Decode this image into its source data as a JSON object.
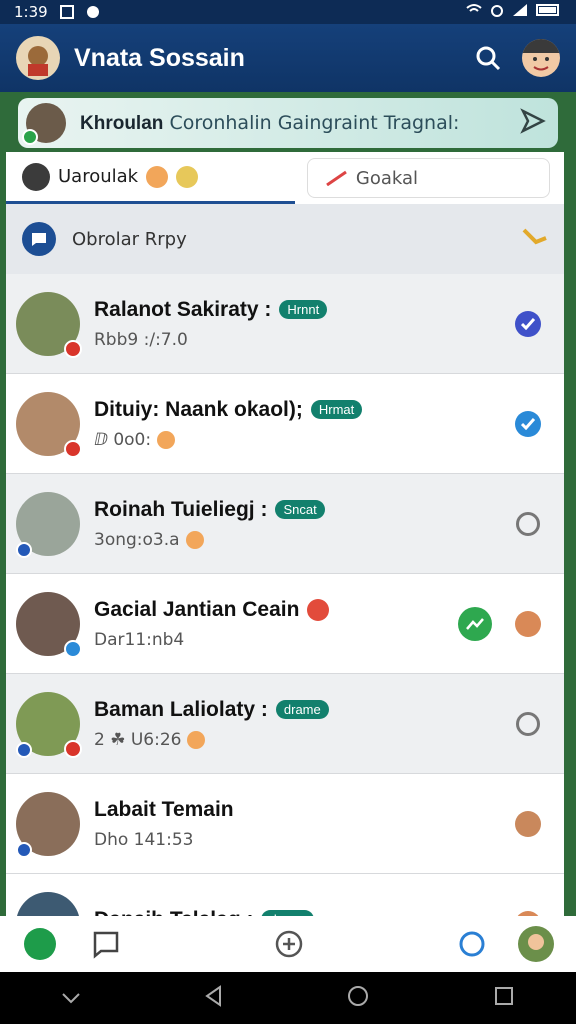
{
  "status_bar": {
    "time": "1:39"
  },
  "app": {
    "title": "Vnata Sossain"
  },
  "banner": {
    "name": "Khroulan",
    "text": "Coronhalin Gaingraint Tragnal:"
  },
  "tabs": [
    {
      "label": "Uaroulak",
      "active": true
    },
    {
      "label": "Goakal",
      "active": false
    }
  ],
  "section": {
    "label": "Obrolar Rrpy"
  },
  "chats": [
    {
      "name": "Ralanot Sakiraty :",
      "tag": "Hrnnt",
      "sub": "Rbb9 :/:7.0",
      "end": "check"
    },
    {
      "name": "Dituiy: Naank okaol);",
      "tag": "Hrmat",
      "sub": "ⅅ 0o0:",
      "end": "check-light"
    },
    {
      "name": "Roinah Tuieliegj :",
      "tag": "Sncat",
      "sub": "3ong:o3.a",
      "end": "sync"
    },
    {
      "name": "Gacial Jantian Ceain",
      "tag": "",
      "sub": "Dar11:nb4",
      "end": "face"
    },
    {
      "name": "Baman Laliolaty :",
      "tag": "drame",
      "sub": "2 ☘ U6:26",
      "end": "sync"
    },
    {
      "name": "Labait Temain",
      "tag": "",
      "sub": "Dho 141:53",
      "end": "face"
    },
    {
      "name": "Danaih Talalag :",
      "tag": "drame",
      "sub": "",
      "end": "face"
    }
  ],
  "colors": {
    "appbar": "#15407a",
    "tag": "#12806d",
    "check": "#3f51c9"
  }
}
